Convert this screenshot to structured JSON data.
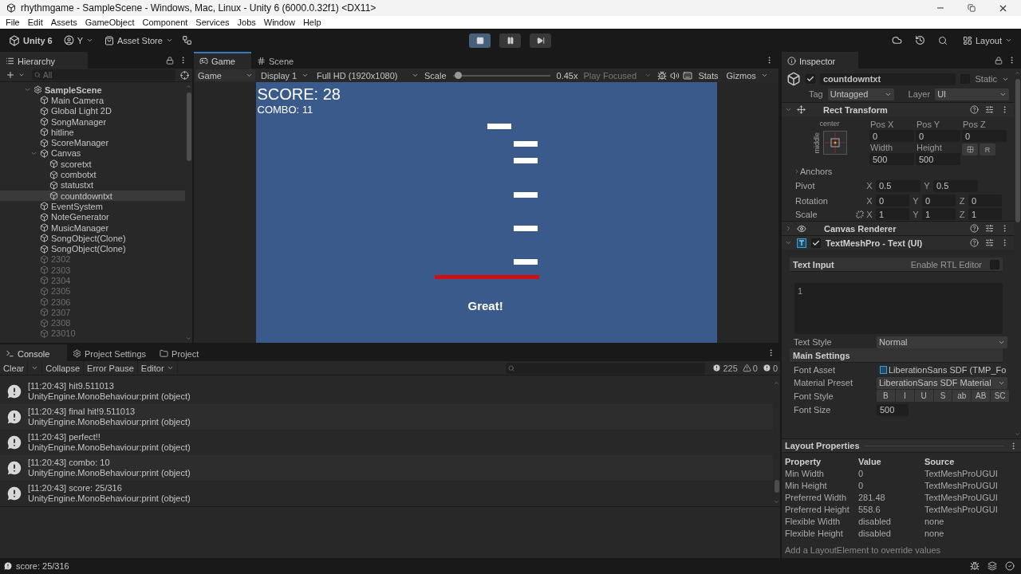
{
  "window": {
    "title": "rhythmgame - SampleScene - Windows, Mac, Linux - Unity 6 (6000.0.32f1) <DX11>"
  },
  "menu": [
    "File",
    "Edit",
    "Assets",
    "GameObject",
    "Component",
    "Services",
    "Jobs",
    "Window",
    "Help"
  ],
  "toolbar": {
    "product": "Unity 6",
    "account": "Y",
    "store": "Asset Store",
    "playing": true,
    "paused": false,
    "layout": "Layout"
  },
  "hierarchy": {
    "title": "Hierarchy",
    "placeholder": "All",
    "scene": {
      "label": "SampleScene",
      "expanded": true
    },
    "items": [
      {
        "label": "Main Camera",
        "selected": false,
        "disabled": false
      },
      {
        "label": "Global Light 2D",
        "selected": false,
        "disabled": false
      },
      {
        "label": "SongManager",
        "selected": false,
        "disabled": false
      },
      {
        "label": "hitline",
        "selected": false,
        "disabled": false
      },
      {
        "label": "ScoreManager",
        "selected": false,
        "disabled": false
      },
      {
        "label": "Canvas",
        "selected": false,
        "disabled": false,
        "expanded": true,
        "children": [
          {
            "label": "scoretxt",
            "selected": false,
            "disabled": false
          },
          {
            "label": "combotxt",
            "selected": false,
            "disabled": false
          },
          {
            "label": "statustxt",
            "selected": false,
            "disabled": false
          },
          {
            "label": "countdowntxt",
            "selected": true,
            "disabled": false
          }
        ]
      },
      {
        "label": "EventSystem",
        "selected": false,
        "disabled": false
      },
      {
        "label": "NoteGenerator",
        "selected": false,
        "disabled": false
      },
      {
        "label": "MusicManager",
        "selected": false,
        "disabled": false
      },
      {
        "label": "SongObject(Clone)",
        "selected": false,
        "disabled": false
      },
      {
        "label": "SongObject(Clone)",
        "selected": false,
        "disabled": false
      },
      {
        "label": "2302",
        "selected": false,
        "disabled": true
      },
      {
        "label": "2303",
        "selected": false,
        "disabled": true
      },
      {
        "label": "2304",
        "selected": false,
        "disabled": true
      },
      {
        "label": "2305",
        "selected": false,
        "disabled": true
      },
      {
        "label": "2306",
        "selected": false,
        "disabled": true
      },
      {
        "label": "2307",
        "selected": false,
        "disabled": true
      },
      {
        "label": "2308",
        "selected": false,
        "disabled": true
      },
      {
        "label": "23010",
        "selected": false,
        "disabled": true
      }
    ]
  },
  "game": {
    "tabs": [
      {
        "label": "Game",
        "selected": true
      },
      {
        "label": "Scene",
        "selected": false
      }
    ],
    "toolbar": {
      "view": "Game",
      "display": "Display 1",
      "resolution": "Full HD (1920x1080)",
      "scale_label": "Scale",
      "scale": {
        "level": 0.02
      },
      "scale_value": "0.45x",
      "play_mode": "Play Focused",
      "stats": "Stats",
      "gizmos": "Gizmos"
    },
    "hud": {
      "score": "SCORE: 28",
      "combo": "COMBO: 11",
      "status": "Great!"
    }
  },
  "console": {
    "tabs": [
      {
        "label": "Console",
        "selected": true
      },
      {
        "label": "Project Settings",
        "selected": false
      },
      {
        "label": "Project",
        "selected": false
      }
    ],
    "toolbar": {
      "clear": "Clear",
      "collapse": "Collapse",
      "error_pause": "Error Pause",
      "editor": "Editor"
    },
    "counts": {
      "log": "225",
      "warning": "0",
      "error": "0"
    },
    "entries": [
      {
        "message": "[11:20:43] hit9.511013",
        "source": "UnityEngine.MonoBehaviour:print (object)"
      },
      {
        "message": "[11:20:43] final hit!9.511013",
        "source": "UnityEngine.MonoBehaviour:print (object)"
      },
      {
        "message": "[11:20:43] perfect!!",
        "source": "UnityEngine.MonoBehaviour:print (object)"
      },
      {
        "message": "[11:20:43] combo: 10",
        "source": "UnityEngine.MonoBehaviour:print (object)"
      },
      {
        "message": "[11:20:43] score: 25/316",
        "source": "UnityEngine.MonoBehaviour:print (object)"
      }
    ]
  },
  "inspector": {
    "title": "Inspector",
    "object": {
      "active": true,
      "name": "countdowntxt",
      "static": false,
      "static_label": "Static",
      "tag_label": "Tag",
      "tag": "Untagged",
      "layer_label": "Layer",
      "layer": "UI"
    },
    "rect_transform": {
      "title": "Rect Transform",
      "expanded": true,
      "anchor_h": "center",
      "anchor_v": "middle",
      "fields": [
        {
          "label": "Pos X",
          "value": "0"
        },
        {
          "label": "Pos Y",
          "value": "0"
        },
        {
          "label": "Pos Z",
          "value": "0"
        },
        {
          "label": "Width",
          "value": "500"
        },
        {
          "label": "Height",
          "value": "500"
        }
      ],
      "raw_button": "R",
      "anchors": "Anchors",
      "vectors": [
        {
          "label": "Pivot",
          "linked": false,
          "axes": [
            {
              "axis": "X",
              "value": "0.5"
            },
            {
              "axis": "Y",
              "value": "0.5"
            }
          ]
        },
        {
          "label": "Rotation",
          "linked": false,
          "axes": [
            {
              "axis": "X",
              "value": "0"
            },
            {
              "axis": "Y",
              "value": "0"
            },
            {
              "axis": "Z",
              "value": "0"
            }
          ]
        },
        {
          "label": "Scale",
          "linked": true,
          "axes": [
            {
              "axis": "X",
              "value": "1"
            },
            {
              "axis": "Y",
              "value": "1"
            },
            {
              "axis": "Z",
              "value": "1"
            }
          ]
        }
      ]
    },
    "canvas_renderer": {
      "title": "Canvas Renderer",
      "expanded": false
    },
    "text_mesh": {
      "title": "TextMeshPro - Text (UI)",
      "enabled": true,
      "expanded": true,
      "text_input": {
        "title": "Text Input",
        "rtl_label": "Enable RTL Editor",
        "rtl": false,
        "value": "1"
      },
      "text_style": {
        "label": "Text Style",
        "value": "Normal"
      },
      "main_settings": "Main Settings",
      "font_asset": {
        "label": "Font Asset",
        "value": "LiberationSans SDF (TMP_Fo"
      },
      "material_preset": {
        "label": "Material Preset",
        "value": "LiberationSans SDF Material"
      },
      "font_style": {
        "label": "Font Style",
        "options": [
          {
            "label": "B",
            "selected": false
          },
          {
            "label": "I",
            "selected": false
          },
          {
            "label": "U",
            "selected": false
          },
          {
            "label": "S",
            "selected": false
          },
          {
            "label": "ab",
            "selected": false
          },
          {
            "label": "AB",
            "selected": false
          },
          {
            "label": "SC",
            "selected": false
          }
        ]
      },
      "font_size": {
        "label": "Font Size",
        "value": "500"
      }
    },
    "layout_properties": {
      "title": "Layout Properties",
      "columns": [
        "Property",
        "Value",
        "Source"
      ],
      "rows": [
        [
          "Min Width",
          "0",
          "TextMeshProUGUI"
        ],
        [
          "Min Height",
          "0",
          "TextMeshProUGUI"
        ],
        [
          "Preferred Width",
          "281.48",
          "TextMeshProUGUI"
        ],
        [
          "Preferred Height",
          "558.6",
          "TextMeshProUGUI"
        ],
        [
          "Flexible Width",
          "disabled",
          "none"
        ],
        [
          "Flexible Height",
          "disabled",
          "none"
        ]
      ],
      "note": "Add a LayoutElement to override values"
    }
  },
  "status_bar": {
    "message": "score: 25/316"
  }
}
